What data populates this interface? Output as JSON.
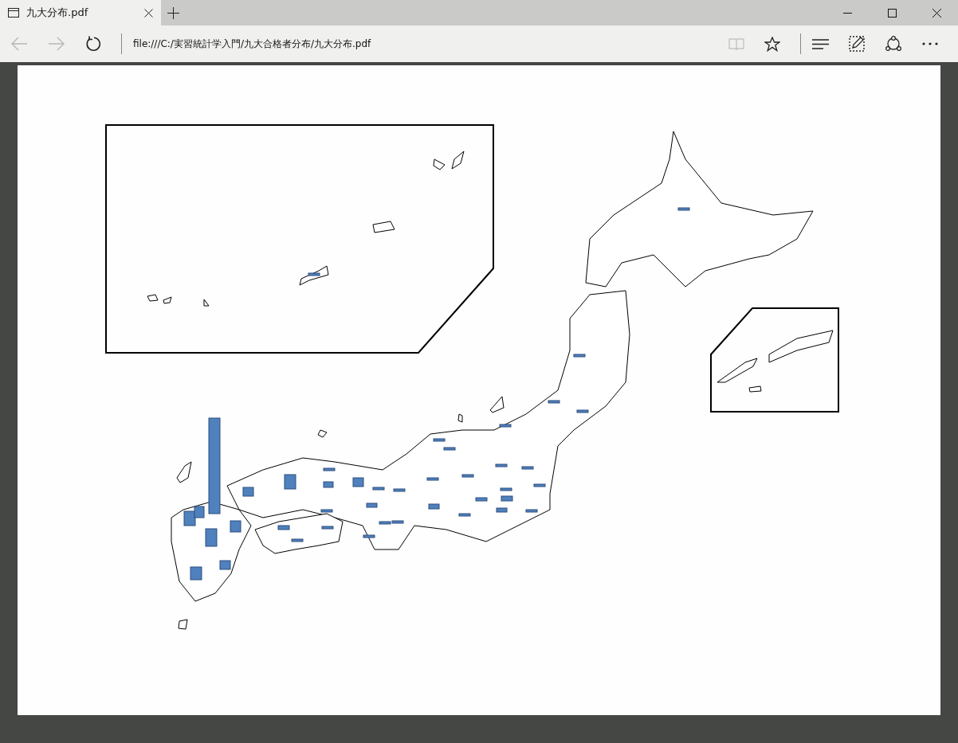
{
  "tabs": [
    {
      "title": "九大分布.pdf",
      "selected": true
    }
  ],
  "toolbar": {
    "back_disabled": true,
    "forward_disabled": true,
    "reading_view_disabled": true,
    "address": "file:///C:/実習統計学入門/九大合格者分布/九大分布.pdf"
  }
}
